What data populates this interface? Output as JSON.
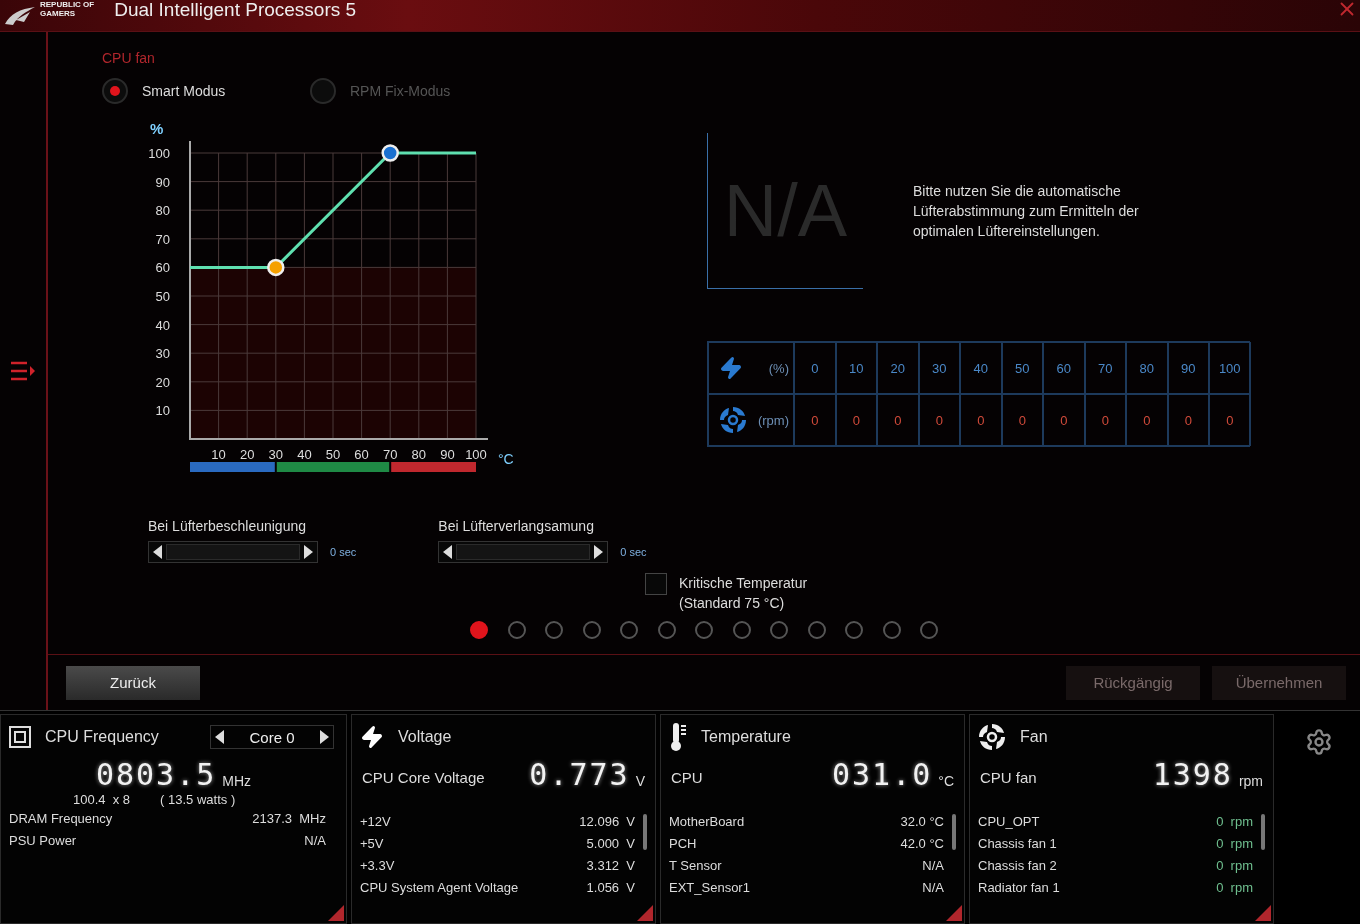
{
  "window": {
    "title": "Dual Intelligent Processors 5",
    "brand": [
      "REPUBLIC OF",
      "GAMERS"
    ]
  },
  "fan_name": "CPU fan",
  "modes": [
    {
      "label": "Smart Modus",
      "selected": true
    },
    {
      "label": "RPM Fix-Modus",
      "selected": false
    }
  ],
  "chart": {
    "chart_data": {
      "type": "line",
      "ylabel": "%",
      "xlabel": "°C",
      "x": [
        0,
        30,
        70,
        100
      ],
      "series": [
        {
          "color": "#5fe0b0",
          "values": [
            60,
            60,
            100,
            100
          ]
        }
      ],
      "grid": true,
      "bands": [
        {
          "axis": "y",
          "from": 0,
          "to": 60,
          "color": "#1c0303"
        }
      ],
      "xlim": [
        0,
        100
      ],
      "ylim": [
        0,
        100
      ],
      "xticks": [
        10,
        20,
        30,
        40,
        50,
        60,
        70,
        80,
        90,
        100
      ],
      "yticks": [
        10,
        20,
        30,
        40,
        50,
        60,
        70,
        80,
        90,
        100
      ]
    }
  },
  "tuning": {
    "value": "N/A",
    "hint": "Bitte nutzen Sie die automatische Lüfterabstimmung zum Ermitteln der optimalen Lüftereinstellungen."
  },
  "rpm_table": {
    "percent_label": "(%)",
    "rpm_label": "(rpm)",
    "percent": [
      "0",
      "10",
      "20",
      "30",
      "40",
      "50",
      "60",
      "70",
      "80",
      "90",
      "100"
    ],
    "rpm": [
      "0",
      "0",
      "0",
      "0",
      "0",
      "0",
      "0",
      "0",
      "0",
      "0",
      "0"
    ]
  },
  "delays": [
    {
      "label": "Bei Lüfterbeschleunigung",
      "value": "0 sec",
      "level": 0
    },
    {
      "label": "Bei Lüfterverlangsamung",
      "value": "0 sec",
      "level": 0
    }
  ],
  "critical_temp": {
    "label": "Kritische Temperatur\n(Standard 75 °C)",
    "checked": false
  },
  "pages": [
    {
      "selected": true
    },
    {
      "selected": false
    },
    {
      "selected": false
    },
    {
      "selected": false
    },
    {
      "selected": false
    },
    {
      "selected": false
    },
    {
      "selected": false
    },
    {
      "selected": false
    },
    {
      "selected": false
    },
    {
      "selected": false
    },
    {
      "selected": false
    },
    {
      "selected": false
    },
    {
      "selected": false
    }
  ],
  "buttons": [
    {
      "label": "Zurück",
      "disabled": false
    },
    {
      "label": "Rückgängig",
      "disabled": true
    },
    {
      "label": "Übernehmen",
      "disabled": true
    }
  ],
  "panels": [
    {
      "kind": "frequency",
      "title": "CPU Frequency",
      "selector": "Core 0",
      "value": "0803.5",
      "unit": "MHz",
      "details": [
        "100.4  x 8",
        "( 13.5 watts )"
      ],
      "rows": [
        {
          "label": "DRAM Frequency",
          "value": "2137.3  MHz"
        },
        {
          "label": "PSU Power",
          "value": "N/A"
        }
      ]
    },
    {
      "kind": "voltage",
      "title": "Voltage",
      "main_label": "CPU Core Voltage",
      "value": "0.773",
      "unit": "V",
      "rows": [
        {
          "label": "+12V",
          "value": "12.096  V"
        },
        {
          "label": "+5V",
          "value": "5.000  V"
        },
        {
          "label": "+3.3V",
          "value": "3.312  V"
        },
        {
          "label": "CPU System Agent Voltage",
          "value": "1.056  V"
        }
      ]
    },
    {
      "kind": "temperature",
      "title": "Temperature",
      "main_label": "CPU",
      "value": "031.0",
      "unit": "°C",
      "rows": [
        {
          "label": "MotherBoard",
          "value": "32.0 °C"
        },
        {
          "label": "PCH",
          "value": "42.0 °C"
        },
        {
          "label": "T Sensor",
          "value": "N/A"
        },
        {
          "label": "EXT_Sensor1",
          "value": "N/A"
        }
      ]
    },
    {
      "kind": "fan",
      "title": "Fan",
      "main_label": "CPU fan",
      "value": "1398",
      "unit": "rpm",
      "rows": [
        {
          "label": "CPU_OPT",
          "value": "0  rpm"
        },
        {
          "label": "Chassis fan 1",
          "value": "0  rpm"
        },
        {
          "label": "Chassis fan 2",
          "value": "0  rpm"
        },
        {
          "label": "Radiator fan 1",
          "value": "0  rpm"
        }
      ]
    }
  ]
}
